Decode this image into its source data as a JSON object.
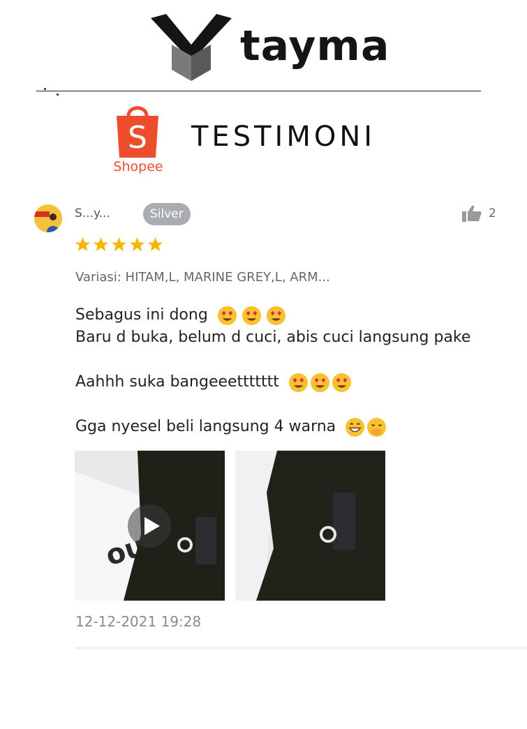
{
  "brand": {
    "name": "tayma",
    "logo_icon": "tayma-v-book-logo-icon"
  },
  "platform": {
    "icon": "shopee-bag-icon",
    "label": "Shopee",
    "color": "#ee4d2d"
  },
  "page_title": "TESTIMONI",
  "review": {
    "username": "S...y...",
    "badge": "Silver",
    "likes": "2",
    "rating": 5,
    "rating_max": 5,
    "variation": "Variasi: HITAM,L, MARINE GREY,L, ARM...",
    "lines": [
      "Sebagus ini dong",
      "Baru d buka, belum d cuci, abis cuci langsung pake",
      "Aahhh suka bangeeettttttt",
      "Gga nyesel beli langsung 4 warna"
    ],
    "timestamp": "12-12-2021 19:28",
    "media": [
      {
        "type": "video",
        "icon": "play-icon"
      },
      {
        "type": "photo"
      }
    ]
  },
  "colors": {
    "star": "#f7b500",
    "silver_badge": "#a9adb1",
    "text_muted": "#8a8a8a"
  }
}
